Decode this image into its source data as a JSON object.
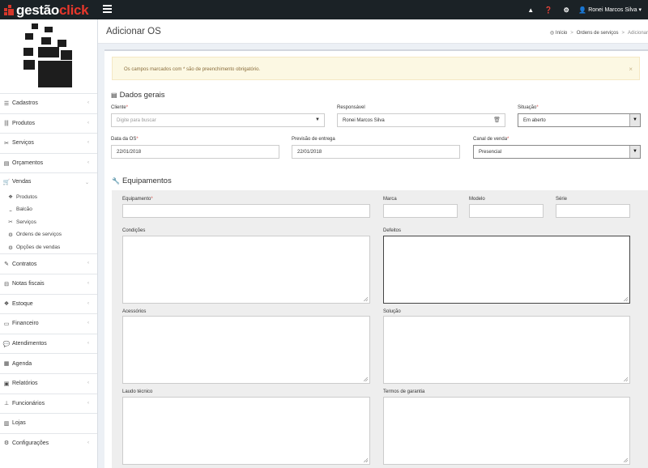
{
  "app": {
    "logo_white": "gestão",
    "logo_red": "click"
  },
  "topbar": {
    "user_name": "Ronei Marcos Silva",
    "user_caret": "▾"
  },
  "sidebar": {
    "items": [
      {
        "label": "Cadastros",
        "icon": "list-icon"
      },
      {
        "label": "Produtos",
        "icon": "barcode-icon"
      },
      {
        "label": "Serviços",
        "icon": "tools-icon"
      },
      {
        "label": "Orçamentos",
        "icon": "document-icon"
      },
      {
        "label": "Vendas",
        "icon": "basket-icon"
      }
    ],
    "vendas_sub": [
      {
        "label": "Produtos"
      },
      {
        "label": "Balcão"
      },
      {
        "label": "Serviços"
      },
      {
        "label": "Ordens de serviços"
      },
      {
        "label": "Opções de vendas"
      }
    ],
    "items2": [
      {
        "label": "Contratos"
      },
      {
        "label": "Notas fiscais"
      },
      {
        "label": "Estoque"
      },
      {
        "label": "Financeiro"
      },
      {
        "label": "Atendimentos"
      },
      {
        "label": "Agenda"
      },
      {
        "label": "Relatórios"
      },
      {
        "label": "Funcionários"
      },
      {
        "label": "Lojas"
      },
      {
        "label": "Configurações"
      }
    ]
  },
  "header": {
    "title": "Adicionar OS",
    "breadcrumb": {
      "home": "Início",
      "section": "Ordens de serviços",
      "current": "Adicionar"
    }
  },
  "alert": {
    "text": "Os campos marcados com * são de preenchimento obrigatório.",
    "close": "×"
  },
  "dados": {
    "title": "Dados gerais",
    "cliente_label": "Cliente",
    "cliente_placeholder": "Digite para buscar",
    "responsavel_label": "Responsável",
    "responsavel_value": "Ronei Marcos Silva",
    "situacao_label": "Situação",
    "situacao_value": "Em aberto",
    "data_os_label": "Data da OS",
    "data_os_value": "22/01/2018",
    "previsao_label": "Previsão de entrega",
    "previsao_value": "22/01/2018",
    "canal_label": "Canal de venda",
    "canal_value": "Presencial"
  },
  "equip": {
    "title": "Equipamentos",
    "equipamento_label": "Equipamento",
    "marca_label": "Marca",
    "modelo_label": "Modelo",
    "serie_label": "Série",
    "condicoes_label": "Condições",
    "defeitos_label": "Defeitos",
    "acessorios_label": "Acessórios",
    "solucao_label": "Solução",
    "laudo_label": "Laudo técnico",
    "termos_label": "Termos de garantia"
  }
}
